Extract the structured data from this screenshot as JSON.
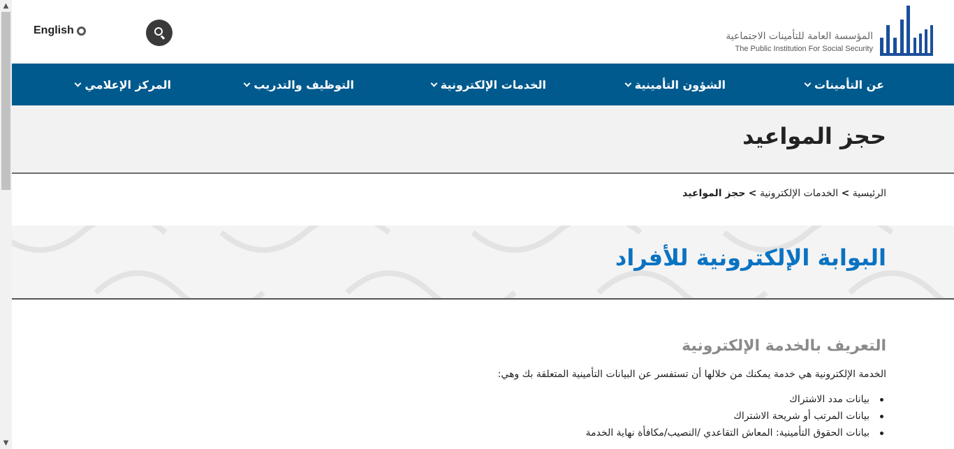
{
  "header": {
    "language_label": "English",
    "logo_arabic": "المؤسسة العامة للتأمينات الاجتماعية",
    "logo_english": "The Public Institution For Social Security"
  },
  "nav": {
    "items": [
      {
        "label": "عن التأمينات"
      },
      {
        "label": "الشؤون التأمينية"
      },
      {
        "label": "الخدمات الإلكترونية"
      },
      {
        "label": "التوظيف والتدريب"
      },
      {
        "label": "المركز الإعلامي"
      }
    ]
  },
  "page": {
    "title": "حجز المواعيد",
    "breadcrumb": {
      "home": "الرئيسية",
      "separator1": ">",
      "section": "الخدمات الإلكترونية",
      "separator2": ">",
      "current": "حجز المواعيد"
    },
    "portal_title": "البوابة الإلكترونية للأفراد",
    "section_title": "التعريف بالخدمة الإلكترونية",
    "intro": "الخدمة الإلكترونية هي خدمة يمكنك من خلالها أن تستفسر عن البيانات التأمينية المتعلقة بك وهي:",
    "bullets": [
      "بيانات مدد الاشتراك",
      "بيانات المرتب أو شريحة الاشتراك",
      "بيانات الحقوق التأمينية: المعاش التقاعدي /النصيب/مكافأة نهاية الخدمة"
    ]
  },
  "colors": {
    "nav_background": "#005a8e",
    "portal_title": "#0a73c2",
    "section_title": "#8a8a8a"
  },
  "icons": {
    "search": "search-icon",
    "globe": "globe-icon",
    "chevron": "chevron-down-icon"
  }
}
